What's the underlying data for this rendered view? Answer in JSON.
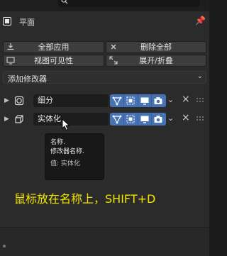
{
  "object": {
    "name": "平面"
  },
  "toolbar": {
    "apply_all": "全部应用",
    "delete_all": "删除全部",
    "viewport_visibility": "视图可见性",
    "expand_collapse": "展开/折叠"
  },
  "add_modifier": {
    "label": "添加修改器"
  },
  "modifiers": [
    {
      "name": "细分",
      "icon": "subdivision-icon"
    },
    {
      "name": "实体化",
      "icon": "solidify-icon"
    }
  ],
  "tooltip": {
    "line1": "名称.",
    "line2": "修改器名称.",
    "value": "值: 实体化"
  },
  "caption": "鼠标放在名称上，SHIFT+D",
  "colors": {
    "accent_blue": "#4772b3",
    "caption_yellow": "#f2e400",
    "panel_bg": "#2b2b2b"
  }
}
